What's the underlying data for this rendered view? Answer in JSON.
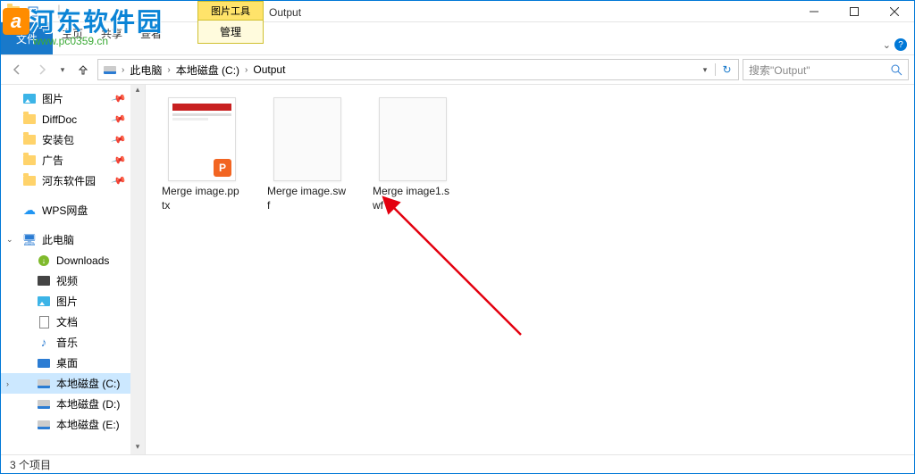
{
  "watermark": {
    "logo_letter": "a",
    "line1": "河东软件园",
    "line2": "www.pc0359.cn"
  },
  "titlebar": {
    "app_title": "Output"
  },
  "ribbon": {
    "file": "文件",
    "tabs": {
      "home": "主页",
      "share": "共享",
      "view": "查看"
    },
    "pic_tools_label": "图片工具",
    "pic_tools_sub": "管理"
  },
  "nav": {
    "breadcrumb": [
      "此电脑",
      "本地磁盘 (C:)",
      "Output"
    ],
    "search_placeholder": "搜索\"Output\""
  },
  "sidebar": {
    "quick": [
      {
        "label": "图片",
        "icon": "pic",
        "pinned": true
      },
      {
        "label": "DiffDoc",
        "icon": "folder",
        "pinned": true
      },
      {
        "label": "安装包",
        "icon": "folder",
        "pinned": true
      },
      {
        "label": "广告",
        "icon": "folder",
        "pinned": true
      },
      {
        "label": "河东软件园",
        "icon": "folder",
        "pinned": true
      }
    ],
    "wps": "WPS网盘",
    "thispc": "此电脑",
    "thispc_children": [
      {
        "label": "Downloads",
        "icon": "dl"
      },
      {
        "label": "视频",
        "icon": "video"
      },
      {
        "label": "图片",
        "icon": "pic"
      },
      {
        "label": "文档",
        "icon": "doc"
      },
      {
        "label": "音乐",
        "icon": "music"
      },
      {
        "label": "桌面",
        "icon": "desktop"
      },
      {
        "label": "本地磁盘 (C:)",
        "icon": "disk",
        "selected": true
      },
      {
        "label": "本地磁盘 (D:)",
        "icon": "disk"
      },
      {
        "label": "本地磁盘 (E:)",
        "icon": "disk"
      }
    ]
  },
  "files": [
    {
      "name": "Merge image.pptx",
      "type": "pptx"
    },
    {
      "name": "Merge image.swf",
      "type": "blank"
    },
    {
      "name": "Merge image1.swf",
      "type": "blank"
    }
  ],
  "status": {
    "count_text": "3 个项目"
  }
}
